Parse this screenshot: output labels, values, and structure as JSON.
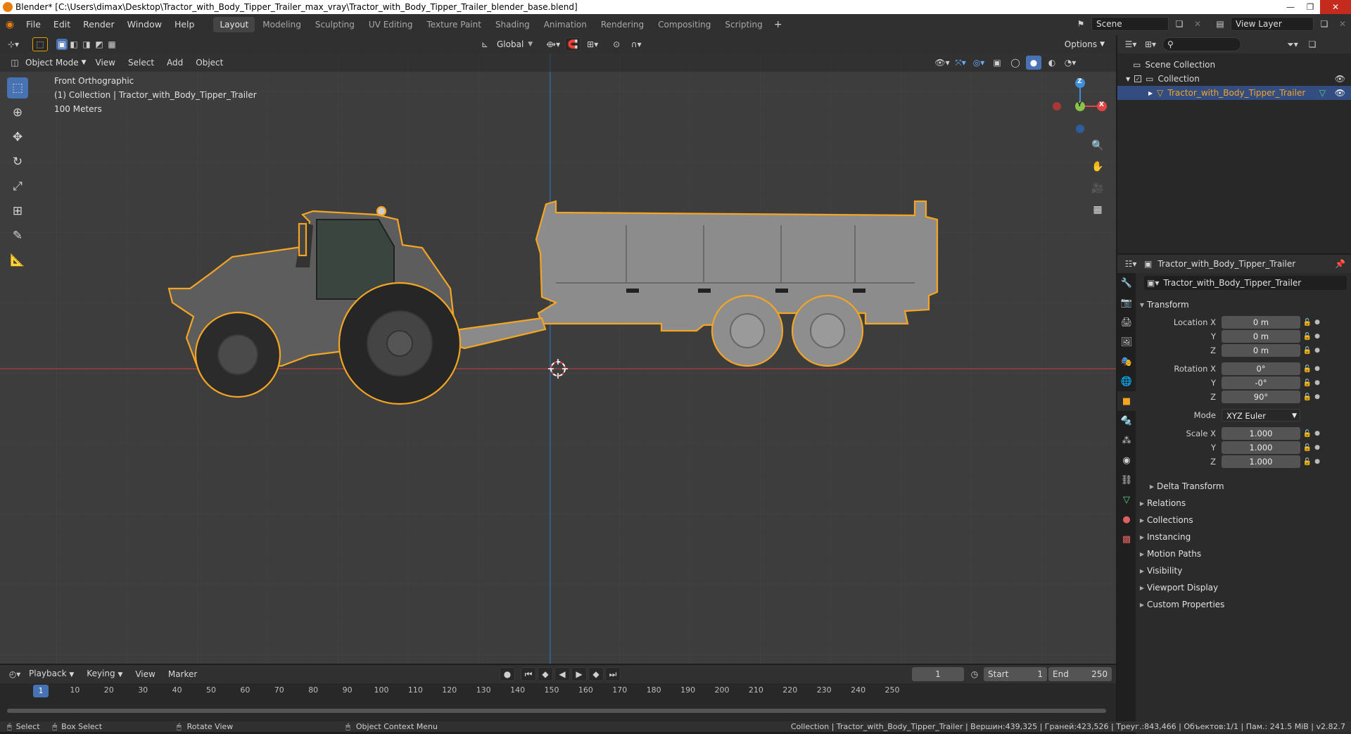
{
  "window": {
    "title": "Blender* [C:\\Users\\dimax\\Desktop\\Tractor_with_Body_Tipper_Trailer_max_vray\\Tractor_with_Body_Tipper_Trailer_blender_base.blend]",
    "minimize": "—",
    "maximize": "❐",
    "close": "✕"
  },
  "menu": [
    "File",
    "Edit",
    "Render",
    "Window",
    "Help"
  ],
  "workspaces": [
    "Layout",
    "Modeling",
    "Sculpting",
    "UV Editing",
    "Texture Paint",
    "Shading",
    "Animation",
    "Rendering",
    "Compositing",
    "Scripting"
  ],
  "active_workspace": "Layout",
  "scene": {
    "label": "Scene",
    "view_layer": "View Layer"
  },
  "viewport": {
    "mode": "Object Mode",
    "header_menu": [
      "View",
      "Select",
      "Add",
      "Object"
    ],
    "orientation": "Global",
    "options_label": "Options",
    "info_view": "Front Orthographic",
    "info_collection": "(1) Collection | Tractor_with_Body_Tipper_Trailer",
    "info_scale": "100 Meters",
    "gizmo": {
      "z": "Z",
      "y": "Y",
      "x": "X"
    }
  },
  "outliner": {
    "scene_collection": "Scene Collection",
    "collection": "Collection",
    "object": "Tractor_with_Body_Tipper_Trailer"
  },
  "properties": {
    "header_object": "Tractor_with_Body_Tipper_Trailer",
    "object_name": "Tractor_with_Body_Tipper_Trailer",
    "transform_label": "Transform",
    "location": {
      "label_x": "Location X",
      "label_y": "Y",
      "label_z": "Z",
      "x": "0 m",
      "y": "0 m",
      "z": "0 m"
    },
    "rotation": {
      "label_x": "Rotation X",
      "label_y": "Y",
      "label_z": "Z",
      "x": "0°",
      "y": "-0°",
      "z": "90°"
    },
    "mode": {
      "label": "Mode",
      "value": "XYZ Euler"
    },
    "scale": {
      "label_x": "Scale X",
      "label_y": "Y",
      "label_z": "Z",
      "x": "1.000",
      "y": "1.000",
      "z": "1.000"
    },
    "delta_transform": "Delta Transform",
    "panels": [
      "Relations",
      "Collections",
      "Instancing",
      "Motion Paths",
      "Visibility",
      "Viewport Display",
      "Custom Properties"
    ]
  },
  "timeline": {
    "menu": [
      "Playback",
      "Keying",
      "View",
      "Marker"
    ],
    "current_frame": "1",
    "start_label": "Start",
    "start": "1",
    "end_label": "End",
    "end": "250",
    "playhead": "1",
    "ruler": [
      "10",
      "20",
      "30",
      "40",
      "50",
      "60",
      "70",
      "80",
      "90",
      "100",
      "110",
      "120",
      "130",
      "140",
      "150",
      "160",
      "170",
      "180",
      "190",
      "200",
      "210",
      "220",
      "230",
      "240",
      "250"
    ]
  },
  "statusbar": {
    "select": "Select",
    "box_select": "Box Select",
    "rotate_view": "Rotate View",
    "context_menu": "Object Context Menu",
    "stats": "Collection | Tractor_with_Body_Tipper_Trailer | Вершин:439,325 | Граней:423,526 | Треуг.:843,466 | Объектов:1/1 | Пам.: 241.5 MiB | v2.82.7"
  },
  "colors": {
    "accent": "#4772b3",
    "selection": "#f5a524",
    "x_axis": "#e04545",
    "y_axis": "#8bc34a",
    "z_axis": "#3d8fdc"
  }
}
